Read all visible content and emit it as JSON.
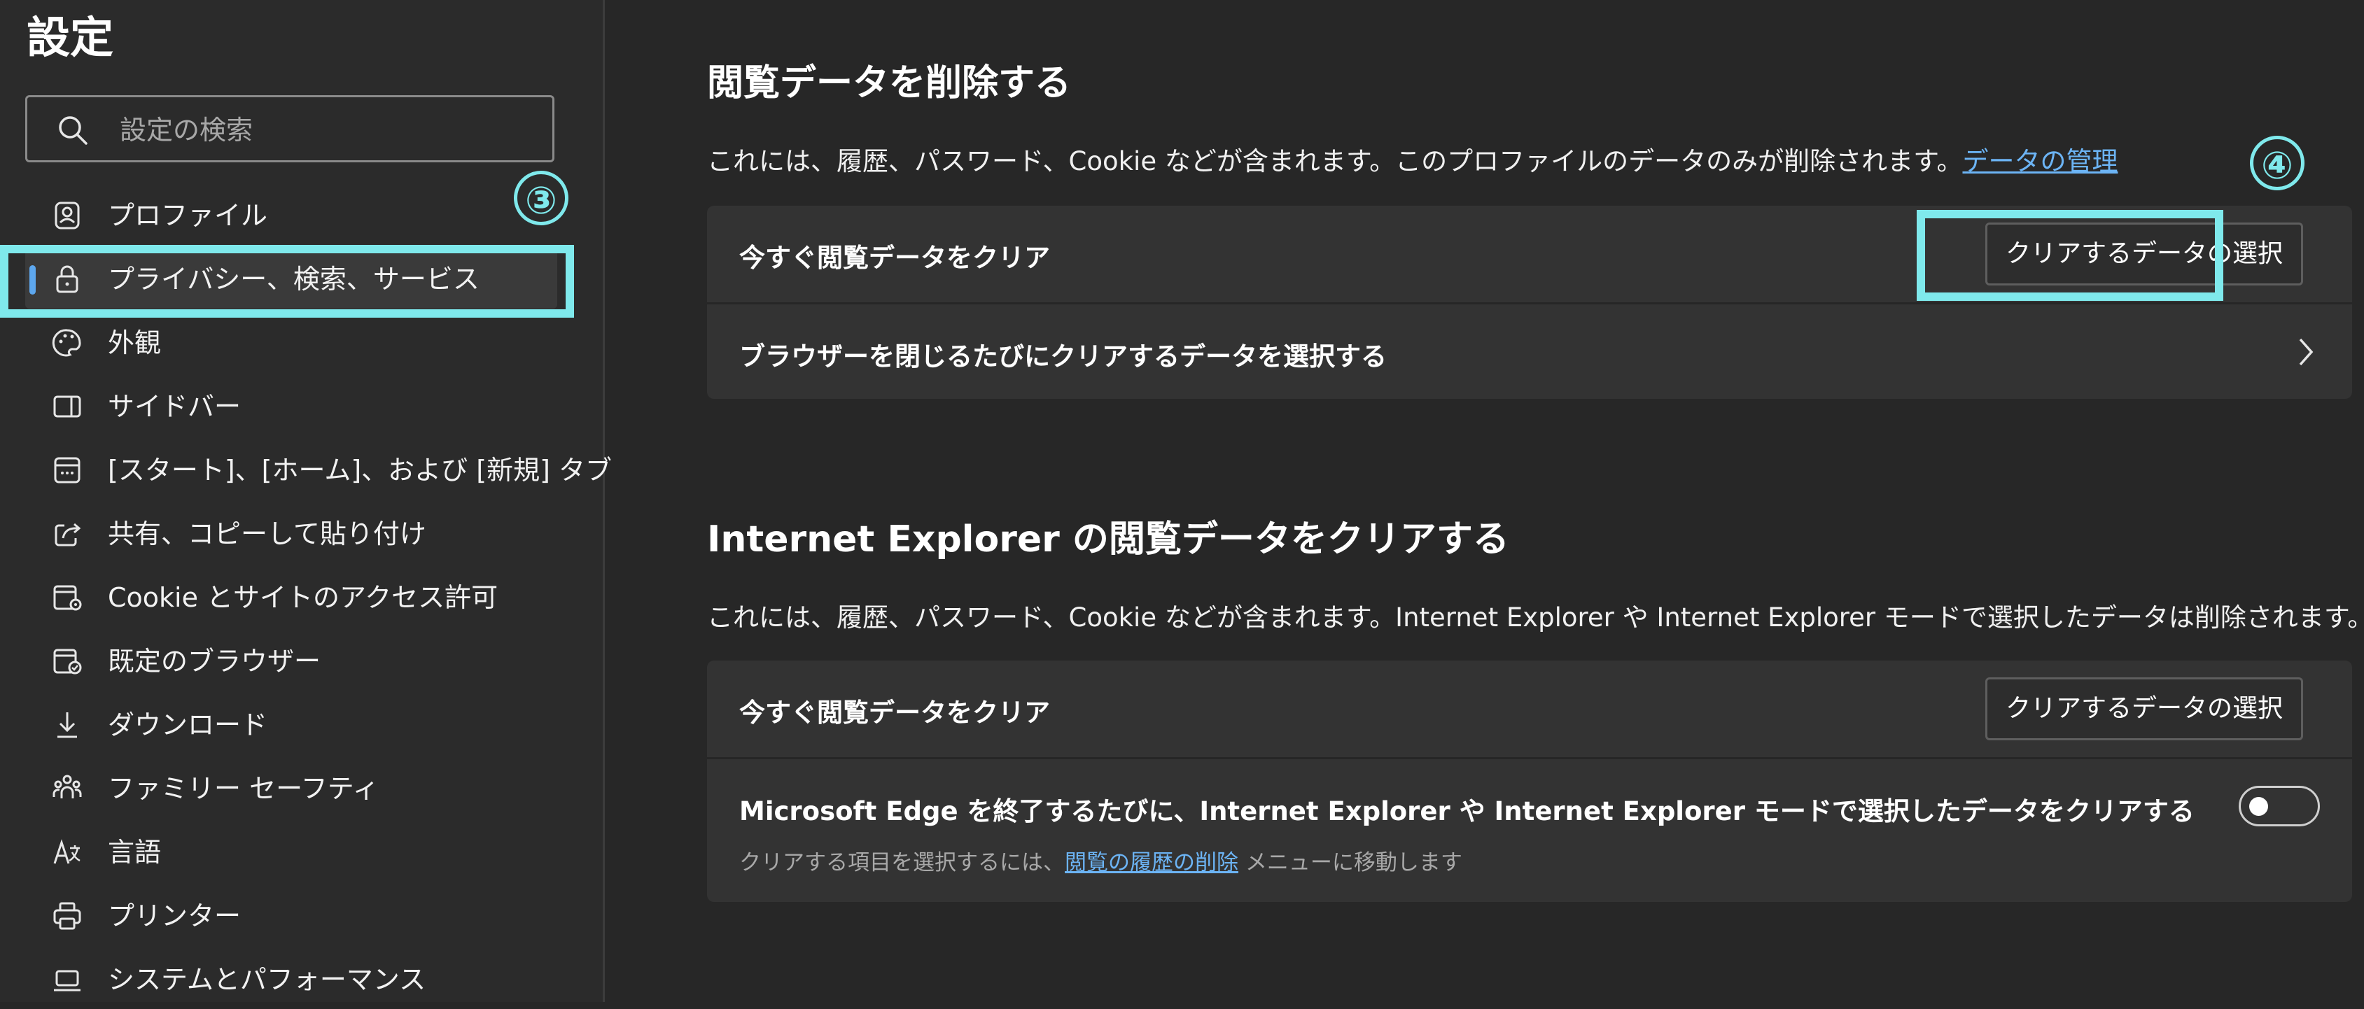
{
  "sidebar": {
    "title": "設定",
    "search_placeholder": "設定の検索",
    "items": [
      {
        "label": "プロファイル",
        "icon": "profile-icon"
      },
      {
        "label": "プライバシー、検索、サービス",
        "icon": "lock-icon",
        "active": true
      },
      {
        "label": "外観",
        "icon": "palette-icon"
      },
      {
        "label": "サイドバー",
        "icon": "sidebar-icon"
      },
      {
        "label": "[スタート]、[ホーム]、および [新規] タブ",
        "icon": "new-tab-icon"
      },
      {
        "label": "共有、コピーして貼り付け",
        "icon": "share-icon"
      },
      {
        "label": "Cookie とサイトのアクセス許可",
        "icon": "site-permissions-icon"
      },
      {
        "label": "既定のブラウザー",
        "icon": "default-browser-icon"
      },
      {
        "label": "ダウンロード",
        "icon": "download-icon"
      },
      {
        "label": "ファミリー セーフティ",
        "icon": "family-icon"
      },
      {
        "label": "言語",
        "icon": "language-icon"
      },
      {
        "label": "プリンター",
        "icon": "printer-icon"
      },
      {
        "label": "システムとパフォーマンス",
        "icon": "laptop-icon"
      }
    ]
  },
  "annotations": {
    "step3": "③",
    "step4": "④",
    "highlight_color": "#7fe9ec"
  },
  "clear_data": {
    "title": "閲覧データを削除する",
    "desc": "これには、履歴、パスワード、Cookie などが含まれます。このプロファイルのデータのみが削除されます。",
    "link": "データの管理",
    "row1_label": "今すぐ閲覧データをクリア",
    "row1_button": "クリアするデータの選択",
    "row2_label": "ブラウザーを閉じるたびにクリアするデータを選択する"
  },
  "ie_data": {
    "title": "Internet Explorer の閲覧データをクリアする",
    "desc": "これには、履歴、パスワード、Cookie などが含まれます。Internet Explorer や Internet Explorer モードで選択したデータは削除されます。",
    "row1_label": "今すぐ閲覧データをクリア",
    "row1_button": "クリアするデータの選択",
    "row2_label": "Microsoft Edge を終了するたびに、Internet Explorer や Internet Explorer モードで選択したデータをクリアする",
    "row2_sub_prefix": "クリアする項目を選択するには、",
    "row2_sub_link": "閲覧の履歴の削除",
    "row2_sub_suffix": " メニューに移動します",
    "toggle_on": false
  },
  "colors": {
    "accent": "#5da7ee",
    "link": "#6cb4f5"
  }
}
